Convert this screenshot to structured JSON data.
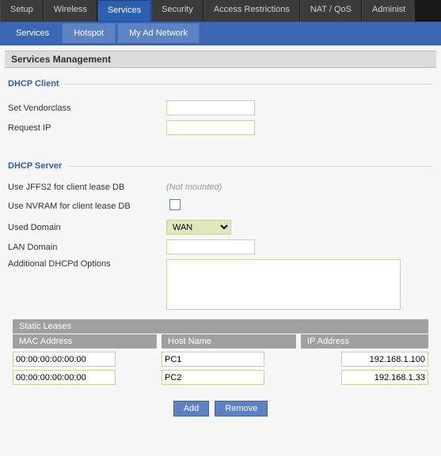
{
  "topnav": {
    "items": [
      "Setup",
      "Wireless",
      "Services",
      "Security",
      "Access Restrictions",
      "NAT / QoS",
      "Administ"
    ],
    "active_index": 2
  },
  "subnav": {
    "items": [
      "Services",
      "Hotspot",
      "My Ad Network"
    ],
    "active_index": 0
  },
  "page_title": "Services Management",
  "dhcp_client": {
    "legend": "DHCP Client",
    "set_vendorclass_label": "Set Vendorclass",
    "set_vendorclass_value": "",
    "request_ip_label": "Request IP",
    "request_ip_value": ""
  },
  "dhcp_server": {
    "legend": "DHCP Server",
    "jffs2_label": "Use JFFS2 for client lease DB",
    "jffs2_status": "(Not mounted)",
    "nvram_label": "Use NVRAM for client lease DB",
    "nvram_checked": false,
    "used_domain_label": "Used Domain",
    "used_domain_value": "WAN",
    "lan_domain_label": "LAN Domain",
    "lan_domain_value": "",
    "dhcpd_opts_label": "Additional DHCPd Options",
    "dhcpd_opts_value": ""
  },
  "leases": {
    "title": "Static Leases",
    "cols": {
      "mac": "MAC Address",
      "host": "Host Name",
      "ip": "IP Address"
    },
    "rows": [
      {
        "mac": "00:00:00:00:00:00",
        "host": "PC1",
        "ip": "192.168.1.100"
      },
      {
        "mac": "00:00:00:00:00:00",
        "host": "PC2",
        "ip": "192.168.1.33"
      }
    ]
  },
  "buttons": {
    "add": "Add",
    "remove": "Remove"
  }
}
